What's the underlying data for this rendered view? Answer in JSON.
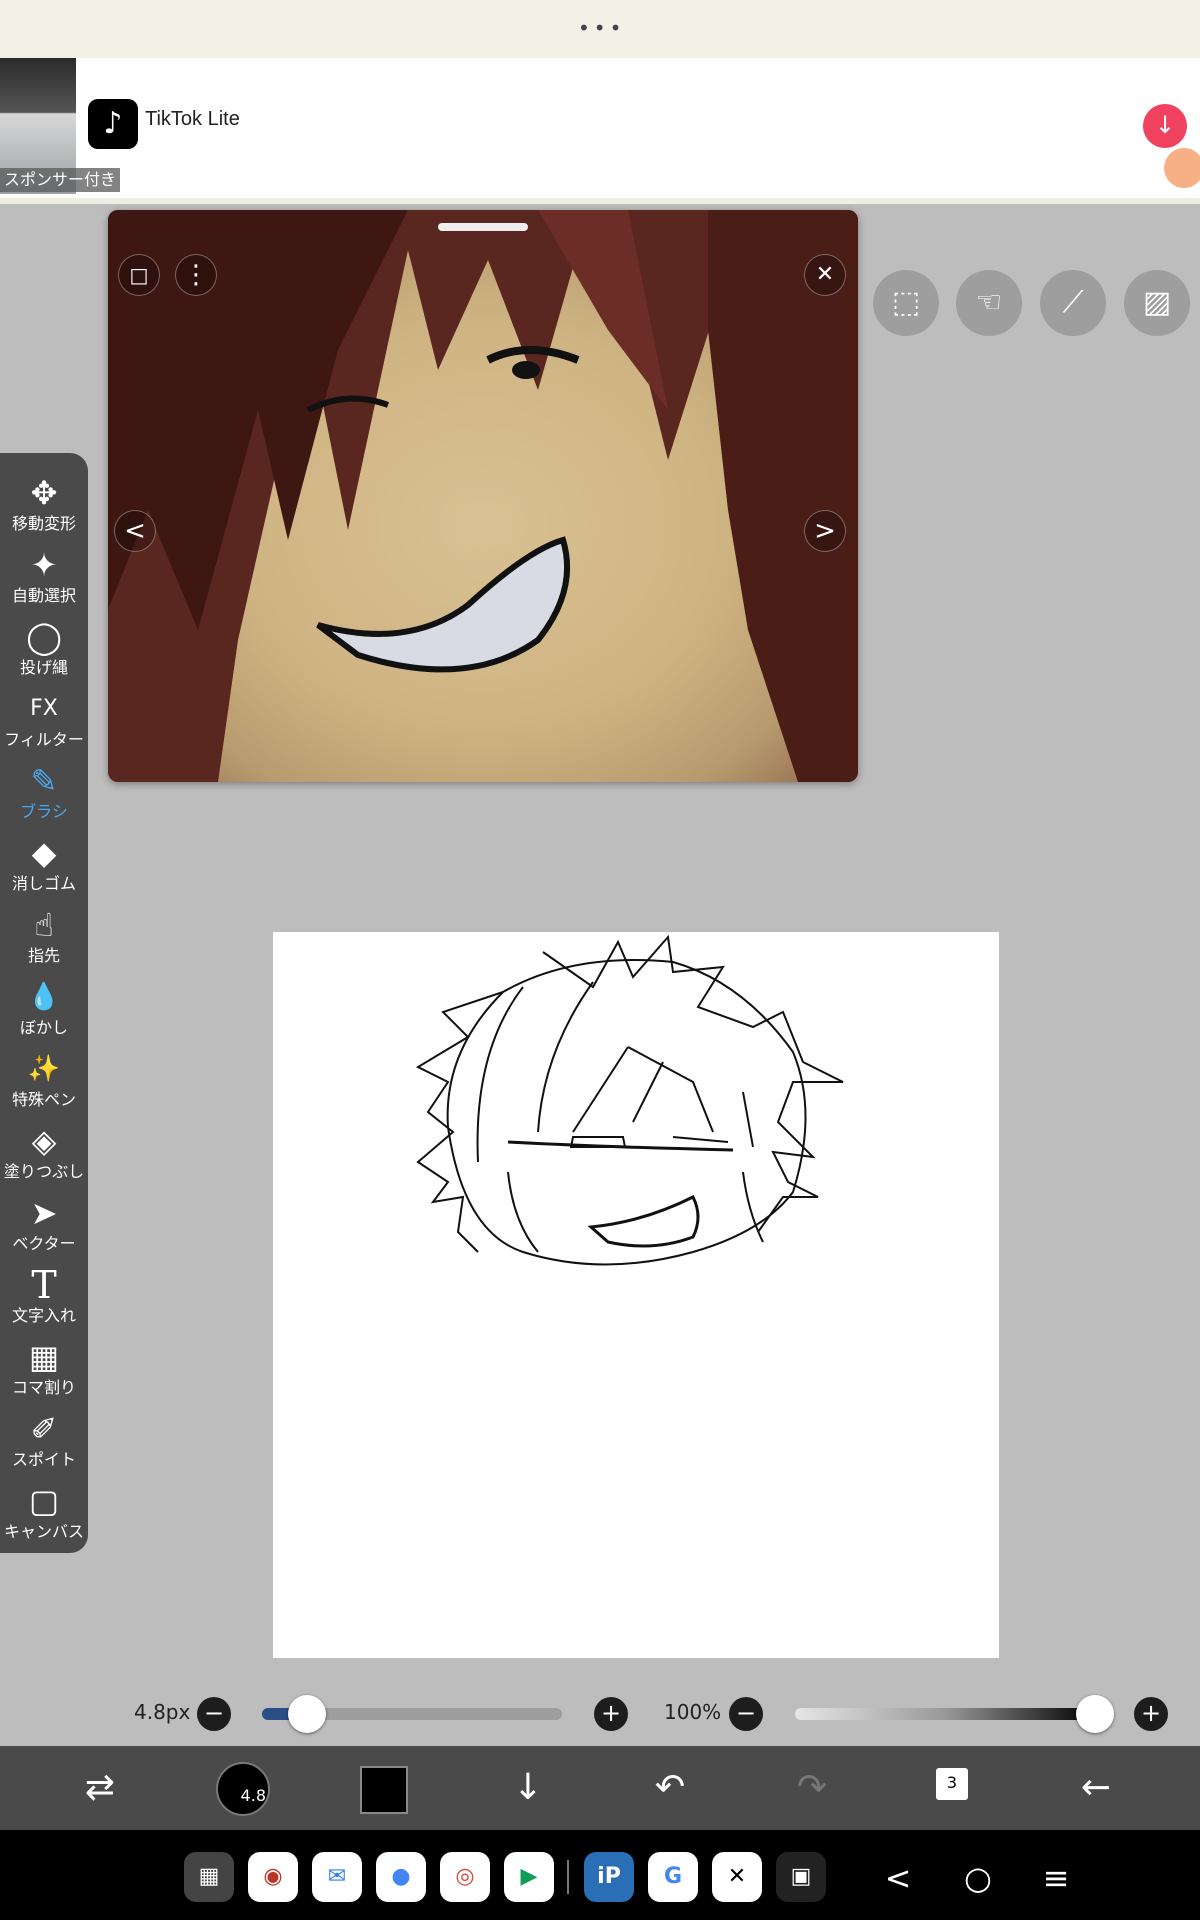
{
  "statusbar": {
    "dots": "•••"
  },
  "ad": {
    "sponsor_label": "スポンサー付き",
    "app_name": "TikTok Lite",
    "logo_glyph": "♪",
    "download_glyph": "↓"
  },
  "reference_window": {
    "frame_icon": "□",
    "more_icon": "⋮",
    "close_icon": "✕",
    "prev_icon": "<",
    "next_icon": ">"
  },
  "top_tools": [
    "selection-icon",
    "hand-icon",
    "ruler-icon",
    "image-icon"
  ],
  "left_tools": [
    {
      "label": "移動変形",
      "icon": "✥"
    },
    {
      "label": "自動選択",
      "icon": "✦"
    },
    {
      "label": "投げ縄",
      "icon": "◯"
    },
    {
      "label": "フィルター",
      "icon": "FX"
    },
    {
      "label": "ブラシ",
      "icon": "✎"
    },
    {
      "label": "消しゴム",
      "icon": "◆"
    },
    {
      "label": "指先",
      "icon": "☝"
    },
    {
      "label": "ぼかし",
      "icon": "💧"
    },
    {
      "label": "特殊ペン",
      "icon": "✨"
    },
    {
      "label": "塗りつぶし",
      "icon": "◈"
    },
    {
      "label": "ベクター",
      "icon": "➤"
    },
    {
      "label": "文字入れ",
      "icon": "T"
    },
    {
      "label": "コマ割り",
      "icon": "▦"
    },
    {
      "label": "スポイト",
      "icon": "✐"
    },
    {
      "label": "キャンバス",
      "icon": "▢"
    }
  ],
  "active_tool": "ブラシ",
  "brush": {
    "size_label": "4.8px",
    "size_fraction": 0.15,
    "preview_value": "4.8"
  },
  "opacity": {
    "label": "100%",
    "fraction": 1.0
  },
  "bottom_toolbar": {
    "layer_count": "3",
    "undo_icon": "↶",
    "redo_icon": "↷",
    "down_icon": "↓",
    "back_icon": "←",
    "swap_icon": "⇄"
  },
  "colors": {
    "primary": "#000000",
    "accent": "#4aa8f0",
    "ad_button": "#f0415e"
  },
  "navbar": {
    "apps": [
      "app-grid",
      "camera",
      "messages",
      "assistant",
      "chrome",
      "play-store",
      "ibispaint",
      "google",
      "capcut",
      "qr-scanner"
    ],
    "back": "<",
    "home": "○",
    "recents": "≡"
  }
}
